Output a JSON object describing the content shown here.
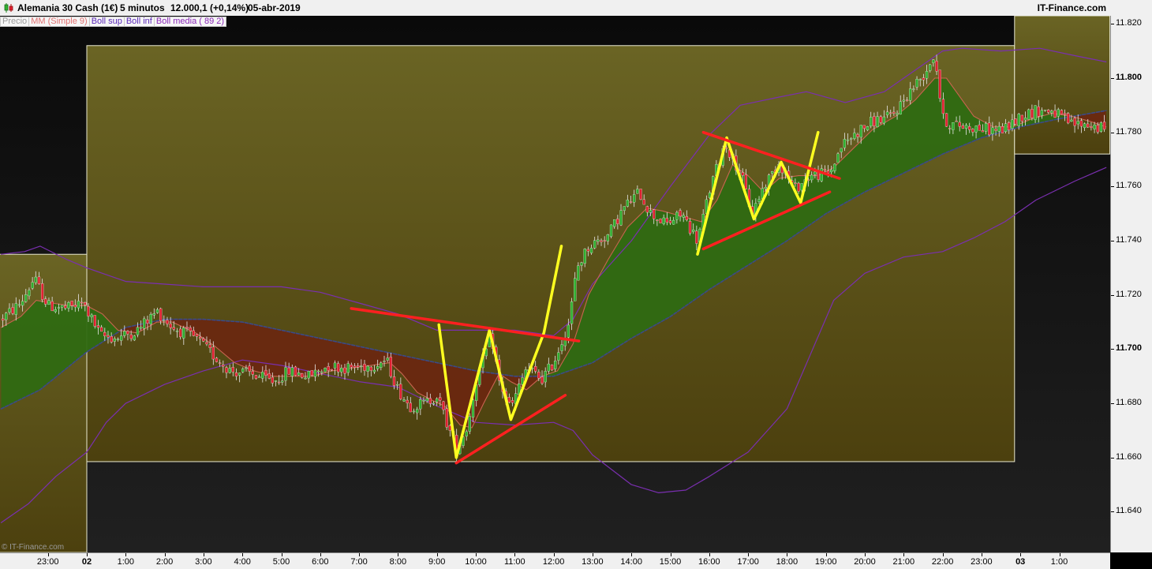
{
  "header": {
    "title": "Alemania 30 Cash (1€)",
    "interval": "5 minutos",
    "price": "12.000,1 (+0,14%)",
    "date": "05-abr-2019",
    "brand": "IT-Finance.com"
  },
  "legend": [
    "Precio",
    "MM (Simple 9)",
    "Boll sup",
    "Boll inf",
    "Boll media ( 89 2)"
  ],
  "watermark": "© IT-Finance.com",
  "colors": {
    "background": "#000000",
    "session_fill": "#5e5418",
    "bull_candle": "#2fb02f",
    "bear_candle": "#e02030",
    "bollinger": "#7a2fb0",
    "fill_green": "#2f6a12",
    "fill_red": "#6a2810",
    "drawing_yellow": "#ffff20",
    "drawing_red": "#ff2020"
  },
  "chart_data": {
    "type": "candlestick",
    "instrument": "Alemania 30 Cash (1€)",
    "timeframe": "5 minutos",
    "ylim": [
      11625,
      11823
    ],
    "y_ticks": [
      {
        "value": 11820,
        "label": "11.820",
        "bold": false
      },
      {
        "value": 11800,
        "label": "11.800",
        "bold": true
      },
      {
        "value": 11780,
        "label": "11.780",
        "bold": false
      },
      {
        "value": 11760,
        "label": "11.760",
        "bold": false
      },
      {
        "value": 11740,
        "label": "11.740",
        "bold": false
      },
      {
        "value": 11720,
        "label": "11.720",
        "bold": false
      },
      {
        "value": 11700,
        "label": "11.700",
        "bold": true
      },
      {
        "value": 11680,
        "label": "11.680",
        "bold": false
      },
      {
        "value": 11660,
        "label": "11.660",
        "bold": false
      },
      {
        "value": 11640,
        "label": "11.640",
        "bold": false
      }
    ],
    "x_ticks": [
      {
        "t": -1,
        "label": "23:00",
        "bold": false
      },
      {
        "t": 0,
        "label": "02",
        "bold": true
      },
      {
        "t": 1,
        "label": "1:00",
        "bold": false
      },
      {
        "t": 2,
        "label": "2:00",
        "bold": false
      },
      {
        "t": 3,
        "label": "3:00",
        "bold": false
      },
      {
        "t": 4,
        "label": "4:00",
        "bold": false
      },
      {
        "t": 5,
        "label": "5:00",
        "bold": false
      },
      {
        "t": 6,
        "label": "6:00",
        "bold": false
      },
      {
        "t": 7,
        "label": "7:00",
        "bold": false
      },
      {
        "t": 8,
        "label": "8:00",
        "bold": false
      },
      {
        "t": 9,
        "label": "9:00",
        "bold": false
      },
      {
        "t": 10,
        "label": "10:00",
        "bold": false
      },
      {
        "t": 11,
        "label": "11:00",
        "bold": false
      },
      {
        "t": 12,
        "label": "12:00",
        "bold": false
      },
      {
        "t": 13,
        "label": "13:00",
        "bold": false
      },
      {
        "t": 14,
        "label": "14:00",
        "bold": false
      },
      {
        "t": 15,
        "label": "15:00",
        "bold": false
      },
      {
        "t": 16,
        "label": "16:00",
        "bold": false
      },
      {
        "t": 17,
        "label": "17:00",
        "bold": false
      },
      {
        "t": 18,
        "label": "18:00",
        "bold": false
      },
      {
        "t": 19,
        "label": "19:00",
        "bold": false
      },
      {
        "t": 20,
        "label": "20:00",
        "bold": false
      },
      {
        "t": 21,
        "label": "21:00",
        "bold": false
      },
      {
        "t": 22,
        "label": "22:00",
        "bold": false
      },
      {
        "t": 23,
        "label": "23:00",
        "bold": false
      },
      {
        "t": 24,
        "label": "03",
        "bold": true
      },
      {
        "t": 25,
        "label": "1:00",
        "bold": false
      }
    ],
    "x_range": [
      -2.25,
      26.3
    ],
    "price_path": [
      [
        -2.2,
        11711
      ],
      [
        -1.7,
        11717
      ],
      [
        -1.35,
        11726
      ],
      [
        -1.0,
        11716
      ],
      [
        -0.5,
        11715
      ],
      [
        -0.1,
        11717
      ],
      [
        0.35,
        11705
      ],
      [
        0.75,
        11704
      ],
      [
        1.3,
        11707
      ],
      [
        1.8,
        11714
      ],
      [
        2.2,
        11708
      ],
      [
        2.8,
        11704
      ],
      [
        3.3,
        11697
      ],
      [
        3.7,
        11692
      ],
      [
        4.2,
        11691
      ],
      [
        4.8,
        11688
      ],
      [
        5.2,
        11692
      ],
      [
        5.7,
        11690
      ],
      [
        6.2,
        11694
      ],
      [
        6.7,
        11693
      ],
      [
        7.3,
        11694
      ],
      [
        7.7,
        11696
      ],
      [
        8.0,
        11685
      ],
      [
        8.3,
        11679
      ],
      [
        8.7,
        11680
      ],
      [
        9.0,
        11683
      ],
      [
        9.5,
        11663
      ],
      [
        9.8,
        11672
      ],
      [
        10.0,
        11688
      ],
      [
        10.4,
        11705
      ],
      [
        10.6,
        11688
      ],
      [
        10.9,
        11678
      ],
      [
        11.3,
        11693
      ],
      [
        11.7,
        11689
      ],
      [
        12.0,
        11695
      ],
      [
        12.4,
        11710
      ],
      [
        12.6,
        11730
      ],
      [
        12.9,
        11738
      ],
      [
        13.4,
        11742
      ],
      [
        13.8,
        11752
      ],
      [
        14.2,
        11758
      ],
      [
        14.5,
        11750
      ],
      [
        14.9,
        11746
      ],
      [
        15.3,
        11750
      ],
      [
        15.7,
        11740
      ],
      [
        16.0,
        11758
      ],
      [
        16.4,
        11776
      ],
      [
        16.8,
        11765
      ],
      [
        17.1,
        11750
      ],
      [
        17.4,
        11760
      ],
      [
        17.8,
        11769
      ],
      [
        18.2,
        11759
      ],
      [
        18.6,
        11764
      ],
      [
        19.1,
        11765
      ],
      [
        19.4,
        11775
      ],
      [
        19.8,
        11780
      ],
      [
        20.2,
        11784
      ],
      [
        20.7,
        11786
      ],
      [
        21.2,
        11796
      ],
      [
        21.5,
        11801
      ],
      [
        21.8,
        11809
      ],
      [
        22.0,
        11785
      ],
      [
        22.2,
        11783
      ],
      [
        22.7,
        11782
      ],
      [
        23.2,
        11781
      ],
      [
        23.6,
        11781
      ],
      [
        24.0,
        11786
      ],
      [
        24.4,
        11788
      ],
      [
        24.8,
        11788
      ],
      [
        25.3,
        11783
      ],
      [
        25.7,
        11783
      ],
      [
        26.2,
        11781
      ]
    ],
    "series": [
      {
        "name": "Boll sup",
        "points": [
          [
            -2.2,
            11735
          ],
          [
            -1.6,
            11736
          ],
          [
            -1.2,
            11738
          ],
          [
            -0.5,
            11733
          ],
          [
            0,
            11730
          ],
          [
            1,
            11725
          ],
          [
            2,
            11724
          ],
          [
            3,
            11723
          ],
          [
            4,
            11723
          ],
          [
            5,
            11723
          ],
          [
            6,
            11721
          ],
          [
            7,
            11717
          ],
          [
            8,
            11713
          ],
          [
            9,
            11707
          ],
          [
            10,
            11707
          ],
          [
            11,
            11707
          ],
          [
            12,
            11705
          ],
          [
            12.5,
            11711
          ],
          [
            13,
            11724
          ],
          [
            14,
            11740
          ],
          [
            15,
            11760
          ],
          [
            16,
            11779
          ],
          [
            16.8,
            11790
          ],
          [
            17.8,
            11793
          ],
          [
            18.5,
            11795
          ],
          [
            19.5,
            11791
          ],
          [
            20.5,
            11795
          ],
          [
            21.3,
            11803
          ],
          [
            22,
            11810
          ],
          [
            22.5,
            11811
          ],
          [
            23.5,
            11810
          ],
          [
            24.5,
            11811
          ],
          [
            25.5,
            11808
          ],
          [
            26.2,
            11806
          ]
        ]
      },
      {
        "name": "Boll inf",
        "points": [
          [
            -2.2,
            11636
          ],
          [
            -1.5,
            11643
          ],
          [
            -0.8,
            11653
          ],
          [
            0,
            11662
          ],
          [
            0.5,
            11673
          ],
          [
            1,
            11680
          ],
          [
            2,
            11687
          ],
          [
            3,
            11692
          ],
          [
            4,
            11696
          ],
          [
            5,
            11694
          ],
          [
            6,
            11691
          ],
          [
            7,
            11688
          ],
          [
            8,
            11686
          ],
          [
            9,
            11679
          ],
          [
            10,
            11673
          ],
          [
            11,
            11672
          ],
          [
            12,
            11673
          ],
          [
            12.5,
            11670
          ],
          [
            13,
            11661
          ],
          [
            14,
            11650
          ],
          [
            14.7,
            11647
          ],
          [
            15.4,
            11648
          ],
          [
            16,
            11653
          ],
          [
            17,
            11662
          ],
          [
            18,
            11678
          ],
          [
            18.6,
            11698
          ],
          [
            19.2,
            11718
          ],
          [
            20,
            11728
          ],
          [
            21,
            11734
          ],
          [
            22,
            11736
          ],
          [
            22.8,
            11741
          ],
          [
            23.6,
            11747
          ],
          [
            24.4,
            11755
          ],
          [
            25.4,
            11762
          ],
          [
            26.2,
            11767
          ]
        ]
      },
      {
        "name": "Boll media ( 89 2)",
        "points": [
          [
            -2.2,
            11678
          ],
          [
            -1.2,
            11685
          ],
          [
            0,
            11699
          ],
          [
            1,
            11708
          ],
          [
            2,
            11711
          ],
          [
            3,
            11711
          ],
          [
            4,
            11710
          ],
          [
            5,
            11707
          ],
          [
            6,
            11704
          ],
          [
            7,
            11701
          ],
          [
            8,
            11698
          ],
          [
            9,
            11695
          ],
          [
            10,
            11692
          ],
          [
            11,
            11690
          ],
          [
            12,
            11690
          ],
          [
            13,
            11695
          ],
          [
            14,
            11704
          ],
          [
            15,
            11712
          ],
          [
            16,
            11722
          ],
          [
            17,
            11731
          ],
          [
            18,
            11740
          ],
          [
            19,
            11750
          ],
          [
            20,
            11758
          ],
          [
            21,
            11765
          ],
          [
            22,
            11772
          ],
          [
            23,
            11778
          ],
          [
            24,
            11782
          ],
          [
            25,
            11785
          ],
          [
            26.2,
            11788
          ]
        ]
      },
      {
        "name": "MM (Simple 9)",
        "points": [
          [
            -2.2,
            11708
          ],
          [
            -1.7,
            11712
          ],
          [
            -1.3,
            11718
          ],
          [
            -0.9,
            11717
          ],
          [
            -0.4,
            11716
          ],
          [
            0,
            11716
          ],
          [
            0.4,
            11713
          ],
          [
            0.8,
            11707
          ],
          [
            1.3,
            11706
          ],
          [
            1.8,
            11710
          ],
          [
            2.2,
            11710
          ],
          [
            2.8,
            11706
          ],
          [
            3.3,
            11701
          ],
          [
            3.8,
            11695
          ],
          [
            4.3,
            11692
          ],
          [
            4.8,
            11690
          ],
          [
            5.3,
            11690
          ],
          [
            5.8,
            11690
          ],
          [
            6.3,
            11692
          ],
          [
            6.8,
            11693
          ],
          [
            7.3,
            11694
          ],
          [
            7.8,
            11695
          ],
          [
            8.1,
            11691
          ],
          [
            8.5,
            11684
          ],
          [
            8.9,
            11681
          ],
          [
            9.2,
            11679
          ],
          [
            9.6,
            11672
          ],
          [
            9.9,
            11671
          ],
          [
            10.2,
            11680
          ],
          [
            10.6,
            11691
          ],
          [
            10.9,
            11688
          ],
          [
            11.3,
            11685
          ],
          [
            11.7,
            11690
          ],
          [
            12.1,
            11692
          ],
          [
            12.5,
            11702
          ],
          [
            12.9,
            11720
          ],
          [
            13.4,
            11733
          ],
          [
            13.9,
            11745
          ],
          [
            14.4,
            11752
          ],
          [
            14.8,
            11751
          ],
          [
            15.3,
            11749
          ],
          [
            15.8,
            11747
          ],
          [
            16.2,
            11755
          ],
          [
            16.6,
            11768
          ],
          [
            17.0,
            11764
          ],
          [
            17.4,
            11758
          ],
          [
            17.8,
            11763
          ],
          [
            18.3,
            11764
          ],
          [
            18.8,
            11764
          ],
          [
            19.2,
            11767
          ],
          [
            19.7,
            11774
          ],
          [
            20.2,
            11781
          ],
          [
            20.8,
            11786
          ],
          [
            21.3,
            11792
          ],
          [
            21.8,
            11800
          ],
          [
            22.1,
            11800
          ],
          [
            22.4,
            11794
          ],
          [
            22.8,
            11786
          ],
          [
            23.3,
            11782
          ],
          [
            23.8,
            11782
          ],
          [
            24.3,
            11785
          ],
          [
            24.8,
            11787
          ],
          [
            25.3,
            11786
          ],
          [
            25.8,
            11784
          ],
          [
            26.2,
            11782
          ]
        ]
      }
    ],
    "highlight_boxes": [
      {
        "t0": -2.25,
        "t1": 0,
        "y_low": 11625,
        "y_high": 11735
      },
      {
        "t0": 0,
        "t1": 23.85,
        "y_low": 11658.5,
        "y_high": 11812
      },
      {
        "t0": 23.85,
        "t1": 26.3,
        "y_low": 11772,
        "y_high": 11823
      }
    ],
    "drawings": [
      {
        "color": "yellow",
        "points": [
          [
            9.05,
            11709
          ],
          [
            9.5,
            11660
          ],
          [
            10.35,
            11707
          ],
          [
            10.9,
            11674
          ],
          [
            11.75,
            11706
          ],
          [
            12.2,
            11738
          ]
        ]
      },
      {
        "color": "yellow",
        "points": [
          [
            15.7,
            11735
          ],
          [
            16.45,
            11778
          ],
          [
            17.15,
            11748
          ],
          [
            17.85,
            11769
          ],
          [
            18.35,
            11754
          ],
          [
            18.8,
            11780
          ]
        ]
      },
      {
        "color": "red",
        "points": [
          [
            6.8,
            11715
          ],
          [
            12.65,
            11703
          ]
        ]
      },
      {
        "color": "red",
        "points": [
          [
            9.5,
            11658
          ],
          [
            12.3,
            11683
          ]
        ]
      },
      {
        "color": "red",
        "points": [
          [
            15.85,
            11780
          ],
          [
            19.35,
            11763
          ]
        ]
      },
      {
        "color": "red",
        "points": [
          [
            15.85,
            11737
          ],
          [
            19.1,
            11758
          ]
        ]
      }
    ]
  }
}
